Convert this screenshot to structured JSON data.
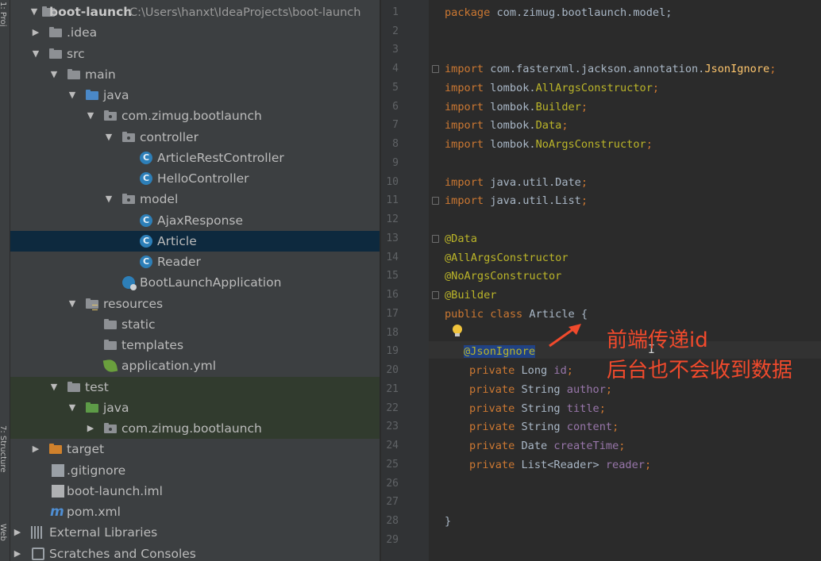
{
  "side_strip": {
    "labels": [
      "1: Proj",
      "7: Structure",
      "Web"
    ]
  },
  "tree": {
    "root_name": "boot-launch",
    "root_path": "C:\\Users\\hanxt\\IdeaProjects\\boot-launch",
    "items": [
      {
        "label": ".idea"
      },
      {
        "label": "src"
      },
      {
        "label": "main"
      },
      {
        "label": "java"
      },
      {
        "label": "com.zimug.bootlaunch"
      },
      {
        "label": "controller"
      },
      {
        "label": "ArticleRestController"
      },
      {
        "label": "HelloController"
      },
      {
        "label": "model"
      },
      {
        "label": "AjaxResponse"
      },
      {
        "label": "Article"
      },
      {
        "label": "Reader"
      },
      {
        "label": "BootLaunchApplication"
      },
      {
        "label": "resources"
      },
      {
        "label": "static"
      },
      {
        "label": "templates"
      },
      {
        "label": "application.yml"
      },
      {
        "label": "test"
      },
      {
        "label": "java"
      },
      {
        "label": "com.zimug.bootlaunch"
      },
      {
        "label": "target"
      },
      {
        "label": ".gitignore"
      },
      {
        "label": "boot-launch.iml"
      },
      {
        "label": "pom.xml"
      },
      {
        "label": "External Libraries"
      },
      {
        "label": "Scratches and Consoles"
      }
    ]
  },
  "editor": {
    "line_numbers": [
      "1",
      "2",
      "3",
      "4",
      "5",
      "6",
      "7",
      "8",
      "9",
      "10",
      "11",
      "12",
      "13",
      "14",
      "15",
      "16",
      "17",
      "18",
      "19",
      "20",
      "21",
      "22",
      "23",
      "24",
      "25",
      "26",
      "27",
      "28",
      "29"
    ],
    "code": {
      "l1_kw": "package",
      "l1_rest": " com.zimug.bootlaunch.model;",
      "l4_pre": " com.fasterxml.jackson.annotation.",
      "l4_cls": "JsonIgnore",
      "l5_pre": " lombok.",
      "l5_cls": "AllArgsConstructor",
      "l6_cls": "Builder",
      "l7_cls": "Data",
      "l8_cls": "NoArgsConstructor",
      "l10_rest": " java.util.Date",
      "l11_rest": " java.util.List",
      "import_kw": "import",
      "semi": ";",
      "l13": "@Data",
      "l14": "@AllArgsConstructor",
      "l15": "@NoArgsConstructor",
      "l16": "@Builder",
      "l17_kw": "public class",
      "l17_rest": " Article {",
      "l19": "@JsonIgnore",
      "private_kw": "private",
      "l20_type": " Long ",
      "l20_f": "id",
      "l21_type": " String ",
      "l21_f": "author",
      "l22_f": "title",
      "l23_f": "content",
      "l24_type": " Date ",
      "l24_f": "createTime",
      "l25_type": " List<Reader> ",
      "l25_f": "reader",
      "l28": "}"
    },
    "annotation_text": [
      "前端传递id",
      "后台也不会收到数据"
    ]
  },
  "colors": {
    "keyword": "#cc7832",
    "annotation": "#bbb529",
    "field": "#9876aa",
    "note": "#f14a2c",
    "selection": "#0d293e"
  }
}
